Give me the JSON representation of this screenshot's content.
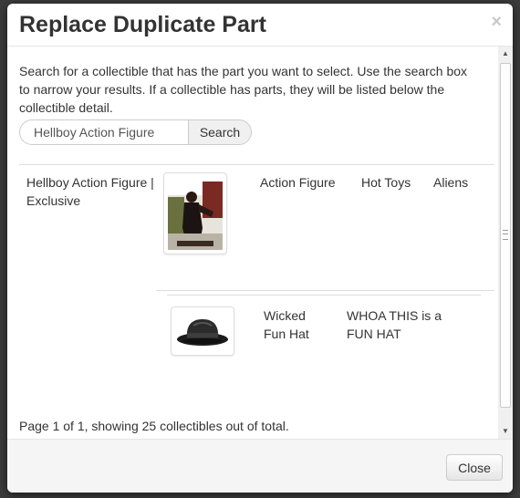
{
  "modal": {
    "title": "Replace Duplicate Part",
    "close_glyph": "×",
    "description": "Search for a collectible that has the part you want to select. Use the search box to narrow your results. If a collectible has parts, they will be listed below the collectible detail.",
    "search": {
      "value": "Hellboy Action Figure",
      "button_label": "Search"
    },
    "results": [
      {
        "name": "Hellboy Action Figure | Exclusive",
        "image_icon": "action-figure-photo",
        "type": "Action Figure",
        "manufacturer": "Hot Toys",
        "license": "Aliens"
      }
    ],
    "parts": [
      {
        "image_icon": "fedora-hat-photo",
        "name": "Wicked Fun Hat",
        "description": "WHOA THIS is a FUN HAT"
      }
    ],
    "pagination_text": "Page 1 of 1, showing 25 collectibles out of total.",
    "footer": {
      "close_label": "Close"
    }
  }
}
